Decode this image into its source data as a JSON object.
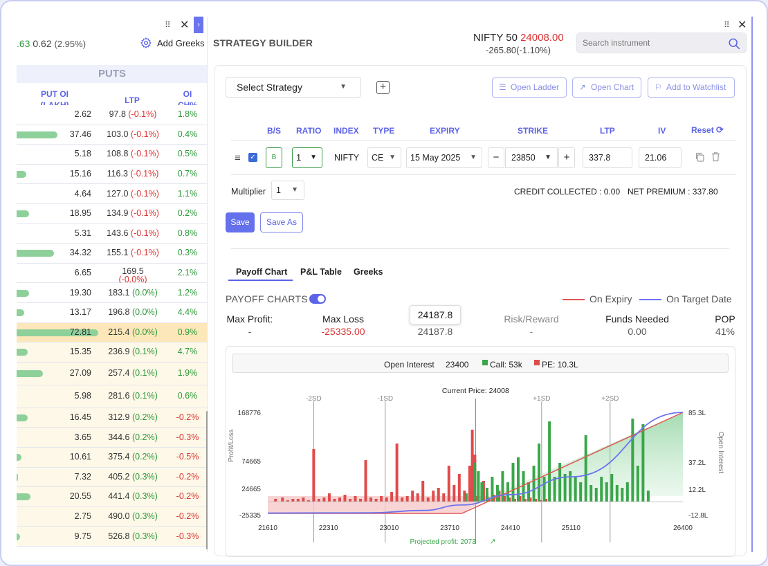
{
  "left_panel": {
    "price_partial": ".63",
    "change": "0.62",
    "change_pct": "(2.95%)",
    "add_greeks": "Add Greeks",
    "section_title": "PUTS",
    "columns": {
      "put_oi_line1": "PUT OI",
      "put_oi_line2": "(LAKH)",
      "ltp": "LTP",
      "oi_line1": "OI",
      "oi_line2": "CH%"
    },
    "rows": [
      {
        "oi": "2.62",
        "ltp": "97.8",
        "ltp_chg": "(-0.1%)",
        "oi_ch": "1.8%",
        "oi_ch_sign": "pos",
        "bar": 0,
        "highlight": "none"
      },
      {
        "oi": "37.46",
        "ltp": "103.0",
        "ltp_chg": "(-0.1%)",
        "oi_ch": "0.4%",
        "oi_ch_sign": "pos",
        "bar": 0.26,
        "highlight": "none"
      },
      {
        "oi": "5.18",
        "ltp": "108.8",
        "ltp_chg": "(-0.1%)",
        "oi_ch": "0.5%",
        "oi_ch_sign": "pos",
        "bar": 0,
        "highlight": "none"
      },
      {
        "oi": "15.16",
        "ltp": "116.3",
        "ltp_chg": "(-0.1%)",
        "oi_ch": "0.7%",
        "oi_ch_sign": "pos",
        "bar": 0.06,
        "highlight": "none"
      },
      {
        "oi": "4.64",
        "ltp": "127.0",
        "ltp_chg": "(-0.1%)",
        "oi_ch": "1.1%",
        "oi_ch_sign": "pos",
        "bar": 0,
        "highlight": "none"
      },
      {
        "oi": "18.95",
        "ltp": "134.9",
        "ltp_chg": "(-0.1%)",
        "oi_ch": "0.2%",
        "oi_ch_sign": "pos",
        "bar": 0.08,
        "highlight": "none"
      },
      {
        "oi": "5.31",
        "ltp": "143.6",
        "ltp_chg": "(-0.1%)",
        "oi_ch": "0.8%",
        "oi_ch_sign": "pos",
        "bar": 0,
        "highlight": "none"
      },
      {
        "oi": "34.32",
        "ltp": "155.1",
        "ltp_chg": "(-0.1%)",
        "oi_ch": "0.3%",
        "oi_ch_sign": "pos",
        "bar": 0.24,
        "highlight": "none"
      },
      {
        "oi": "6.65",
        "ltp": "169.5",
        "ltp_chg": "(-0.0%)",
        "oi_ch": "2.1%",
        "oi_ch_sign": "pos",
        "bar": 0,
        "highlight": "none",
        "two_line": true
      },
      {
        "oi": "19.30",
        "ltp": "183.1",
        "ltp_chg": "(0.0%)",
        "oi_ch": "1.2%",
        "oi_ch_sign": "pos",
        "bar": 0.08,
        "highlight": "none"
      },
      {
        "oi": "13.17",
        "ltp": "196.8",
        "ltp_chg": "(0.0%)",
        "oi_ch": "4.4%",
        "oi_ch_sign": "pos",
        "bar": 0.05,
        "highlight": "none"
      },
      {
        "oi": "72.81",
        "ltp": "215.4",
        "ltp_chg": "(0.0%)",
        "oi_ch": "0.9%",
        "oi_ch_sign": "pos",
        "bar": 0.52,
        "highlight": "atm"
      },
      {
        "oi": "15.35",
        "ltp": "236.9",
        "ltp_chg": "(0.1%)",
        "oi_ch": "4.7%",
        "oi_ch_sign": "pos",
        "bar": 0.07,
        "highlight": "itm"
      },
      {
        "oi": "27.09",
        "ltp": "257.4",
        "ltp_chg": "(0.1%)",
        "oi_ch": "1.9%",
        "oi_ch_sign": "pos",
        "bar": 0.17,
        "highlight": "itm",
        "tall": true
      },
      {
        "oi": "5.98",
        "ltp": "281.6",
        "ltp_chg": "(0.1%)",
        "oi_ch": "0.6%",
        "oi_ch_sign": "pos",
        "bar": 0,
        "highlight": "itm",
        "tall": true
      },
      {
        "oi": "16.45",
        "ltp": "312.9",
        "ltp_chg": "(0.2%)",
        "oi_ch": "-0.2%",
        "oi_ch_sign": "neg",
        "bar": 0.07,
        "highlight": "itm"
      },
      {
        "oi": "3.65",
        "ltp": "344.6",
        "ltp_chg": "(0.2%)",
        "oi_ch": "-0.3%",
        "oi_ch_sign": "neg",
        "bar": 0,
        "highlight": "itm"
      },
      {
        "oi": "10.61",
        "ltp": "375.4",
        "ltp_chg": "(0.2%)",
        "oi_ch": "-0.5%",
        "oi_ch_sign": "neg",
        "bar": 0.03,
        "highlight": "itm"
      },
      {
        "oi": "7.32",
        "ltp": "405.2",
        "ltp_chg": "(0.3%)",
        "oi_ch": "-0.2%",
        "oi_ch_sign": "neg",
        "bar": 0.01,
        "highlight": "itm"
      },
      {
        "oi": "20.55",
        "ltp": "441.4",
        "ltp_chg": "(0.3%)",
        "oi_ch": "-0.2%",
        "oi_ch_sign": "neg",
        "bar": 0.09,
        "highlight": "itm"
      },
      {
        "oi": "2.75",
        "ltp": "490.0",
        "ltp_chg": "(0.3%)",
        "oi_ch": "-0.2%",
        "oi_ch_sign": "neg",
        "bar": 0,
        "highlight": "itm"
      },
      {
        "oi": "9.75",
        "ltp": "526.8",
        "ltp_chg": "(0.3%)",
        "oi_ch": "-0.3%",
        "oi_ch_sign": "neg",
        "bar": 0.02,
        "highlight": "itm"
      }
    ]
  },
  "header": {
    "title": "STRATEGY BUILDER",
    "instrument": "NIFTY 50",
    "instrument_price": "24008.00",
    "instrument_change": "-265.80(-1.10%)",
    "search_placeholder": "Search instrument"
  },
  "toolbar": {
    "select_strategy": "Select Strategy",
    "open_ladder": "Open Ladder",
    "open_chart": "Open Chart",
    "add_watchlist": "Add to Watchlist"
  },
  "legs_table": {
    "headers": {
      "bs": "B/S",
      "ratio": "RATIO",
      "index": "INDEX",
      "type": "TYPE",
      "expiry": "EXPIRY",
      "strike": "STRIKE",
      "ltp": "LTP",
      "iv": "IV",
      "reset": "Reset"
    },
    "leg": {
      "bs": "B",
      "ratio": "1",
      "index": "NIFTY",
      "type": "CE",
      "expiry": "15 May 2025",
      "strike": "23850",
      "ltp": "337.8",
      "iv": "21.06"
    }
  },
  "summary": {
    "multiplier_label": "Multiplier",
    "multiplier_value": "1",
    "credit": "CREDIT COLLECTED : 0.00",
    "net_premium": "NET PREMIUM : 337.80",
    "save": "Save",
    "save_as": "Save As"
  },
  "tabs": [
    "Payoff Chart",
    "P&L Table",
    "Greeks"
  ],
  "payoff": {
    "label": "PAYOFF CHARTS",
    "legend_expiry": "On Expiry",
    "legend_target": "On Target Date",
    "stats": [
      {
        "label": "Max Profit:",
        "value": "-",
        "color": "#555555"
      },
      {
        "label": "Max Loss",
        "value": "-25335.00",
        "color": "#d33333"
      },
      {
        "label": "",
        "value": "24187.8",
        "color": "#555555"
      },
      {
        "label": "Risk/Reward",
        "value": "-",
        "color": "#888888"
      },
      {
        "label": "Funds Needed",
        "value": "0.00",
        "color": "#555555"
      },
      {
        "label": "POP",
        "value": "41%",
        "color": "#555555"
      }
    ],
    "tooltip": "24187.8"
  },
  "oi_bar": {
    "label": "Open Interest",
    "strike": "23400",
    "call": "Call: 53k",
    "pe": "PE: 10.3L"
  },
  "colors": {
    "accent": "#5b63e6",
    "call": "#3aa64a",
    "put": "#e04b4b",
    "expiry_line": "#e05555",
    "target_line": "#6b74f0"
  },
  "chart_data": {
    "type": "bar",
    "current_price_label": "Current Price: 24008",
    "projected_label": "Projected profit: 2073",
    "x_ticks": [
      "21610",
      "22310",
      "23010",
      "23710",
      "24410",
      "25110",
      "26400"
    ],
    "y_left_ticks": [
      "168776",
      "74665",
      "24665",
      "-25335"
    ],
    "y_right_ticks": [
      "85.3L",
      "37.2L",
      "12.2L",
      "-12.8L"
    ],
    "y_left_label": "Profit/Loss",
    "y_right_label": "Open Interest",
    "sd_lines": [
      {
        "label": "-2SD",
        "x": 22140
      },
      {
        "label": "-1SD",
        "x": 22965
      },
      {
        "label": "+1SD",
        "x": 24770
      },
      {
        "label": "+2SD",
        "x": 25560
      }
    ],
    "current_price": 24008,
    "x_range": [
      21610,
      26400
    ],
    "puts_oi": [
      [
        21700,
        2
      ],
      [
        21780,
        3
      ],
      [
        21840,
        1
      ],
      [
        21900,
        2
      ],
      [
        21960,
        2
      ],
      [
        22020,
        3
      ],
      [
        22080,
        1
      ],
      [
        22140,
        38
      ],
      [
        22200,
        2
      ],
      [
        22260,
        3
      ],
      [
        22320,
        6
      ],
      [
        22380,
        2
      ],
      [
        22440,
        3
      ],
      [
        22500,
        5
      ],
      [
        22560,
        2
      ],
      [
        22620,
        4
      ],
      [
        22680,
        2
      ],
      [
        22740,
        30
      ],
      [
        22800,
        3
      ],
      [
        22860,
        2
      ],
      [
        22920,
        4
      ],
      [
        22980,
        3
      ],
      [
        23040,
        7
      ],
      [
        23100,
        42
      ],
      [
        23160,
        3
      ],
      [
        23220,
        4
      ],
      [
        23280,
        8
      ],
      [
        23340,
        6
      ],
      [
        23400,
        15
      ],
      [
        23460,
        3
      ],
      [
        23520,
        8
      ],
      [
        23580,
        10
      ],
      [
        23640,
        6
      ],
      [
        23700,
        26
      ],
      [
        23760,
        12
      ],
      [
        23820,
        20
      ],
      [
        23880,
        8
      ],
      [
        23940,
        26
      ],
      [
        23970,
        52
      ],
      [
        24000,
        34
      ],
      [
        24030,
        4
      ],
      [
        24100,
        15
      ],
      [
        24160,
        3
      ],
      [
        24220,
        5
      ],
      [
        24280,
        8
      ],
      [
        24340,
        4
      ],
      [
        24400,
        3
      ],
      [
        24460,
        2
      ],
      [
        24520,
        4
      ],
      [
        24580,
        2
      ],
      [
        24640,
        3
      ],
      [
        24700,
        2
      ],
      [
        24760,
        1
      ],
      [
        24820,
        2
      ]
    ],
    "calls_oi": [
      [
        23900,
        6
      ],
      [
        24000,
        28
      ],
      [
        24040,
        22
      ],
      [
        24080,
        14
      ],
      [
        24140,
        10
      ],
      [
        24200,
        18
      ],
      [
        24260,
        12
      ],
      [
        24320,
        22
      ],
      [
        24380,
        14
      ],
      [
        24440,
        28
      ],
      [
        24500,
        32
      ],
      [
        24560,
        22
      ],
      [
        24620,
        14
      ],
      [
        24680,
        26
      ],
      [
        24740,
        42
      ],
      [
        24800,
        18
      ],
      [
        24860,
        58
      ],
      [
        24920,
        18
      ],
      [
        24980,
        28
      ],
      [
        25040,
        20
      ],
      [
        25100,
        22
      ],
      [
        25160,
        18
      ],
      [
        25220,
        14
      ],
      [
        25280,
        48
      ],
      [
        25340,
        12
      ],
      [
        25400,
        10
      ],
      [
        25460,
        18
      ],
      [
        25520,
        14
      ],
      [
        25580,
        20
      ],
      [
        25640,
        12
      ],
      [
        25700,
        10
      ],
      [
        25760,
        14
      ],
      [
        25820,
        60
      ],
      [
        25880,
        26
      ],
      [
        25940,
        56
      ],
      [
        26000,
        8
      ]
    ],
    "expiry_payoff": [
      [
        21610,
        -25335
      ],
      [
        23850,
        -25335
      ],
      [
        26400,
        122000
      ]
    ],
    "target_payoff": [
      [
        21610,
        -24800
      ],
      [
        22800,
        -24500
      ],
      [
        23400,
        -21000
      ],
      [
        23850,
        -13000
      ],
      [
        24410,
        2000
      ],
      [
        25110,
        28000
      ],
      [
        26400,
        122000
      ]
    ]
  }
}
